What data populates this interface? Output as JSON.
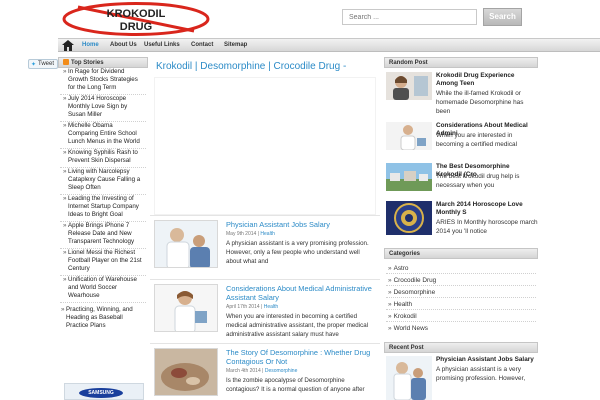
{
  "header": {
    "logo_text_1": "KROKODIL",
    "logo_text_2": "DRUG",
    "search_placeholder": "Search ...",
    "search_button": "Search"
  },
  "nav": {
    "items": [
      "Home",
      "About Us",
      "Useful Links",
      "Contact",
      "Sitemap"
    ]
  },
  "tweet_label": "Tweet",
  "top_stories": {
    "title": "Top Stories",
    "items": [
      "In Rage for Dividend Growth Stocks Strategies for the Long Term",
      "July 2014 Horoscope Monthly Love Sign by Susan Miller",
      "Michelle Obama Comparing Entire School Lunch Menus in the World",
      "Knowing Syphilis Rash to Prevent Skin Dispersal",
      "Living with Narcolepsy Cataplexy Cause Falling a Sleep Often",
      "Leading the Investing of Internet Startup Company Ideas to Bright Goal",
      "Apple Brings iPhone 7 Release Date and New Transparent Technology",
      "Lionel Messi the Richest Football Player on the 21st Century",
      "Unification of Warehouse and World Soccer Wearhouse",
      "Practicing, Winning, and Heading as Baseball Practice Plans"
    ]
  },
  "ad_brand": "SAMSUNG",
  "main": {
    "title": "Krokodil | Desomorphine | Crocodile Drug -",
    "posts": [
      {
        "title": "Physician Assistant Jobs Salary",
        "date": "May 9th 2014",
        "category": "Health",
        "excerpt": "A physician assistant is a very promising profession. However, only a few people who understand well about what and"
      },
      {
        "title": "Considerations About Medical Administrative Assistant Salary",
        "date": "April 17th 2014",
        "category": "Health",
        "excerpt": "When you are interested in becoming a certified medical administrative assistant, the proper medical administrative assistant salary must have"
      },
      {
        "title": "The Story Of Desomorphine : Whether Drug Contagious Or Not",
        "date": "March 4th 2014",
        "category": "Desomorphine",
        "excerpt": "Is the zombie apocalypse of Desomorphine contagious? It is a normal question of anyone after"
      }
    ]
  },
  "random_post": {
    "title": "Random Post",
    "items": [
      {
        "title": "Krokodil Drug Experience Among Teen",
        "text": "While the ill-famed Krokodil or homemade Desomorphine has been"
      },
      {
        "title": "Considerations About Medical Admini",
        "text": "When you are interested in becoming a certified medical"
      },
      {
        "title": "The Best Desomorphine Krokodil (Cro",
        "text": "The best krokodil drug help is necessary when you"
      },
      {
        "title": "March 2014 Horoscope Love Monthly S",
        "text": "ARIES In Monthly horoscope march 2014 you 'll notice"
      }
    ]
  },
  "categories": {
    "title": "Categories",
    "items": [
      "Astro",
      "Crocodile Drug",
      "Desomorphine",
      "Health",
      "Krokodil",
      "World News"
    ]
  },
  "recent_post": {
    "title": "Recent Post",
    "items": [
      {
        "title": "Physician Assistant Jobs Salary",
        "text": "A physician assistant is a very promising profession. However,"
      }
    ]
  }
}
